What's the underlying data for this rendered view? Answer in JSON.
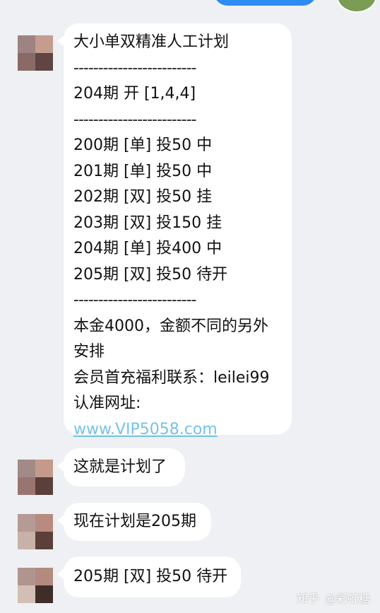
{
  "main_message": {
    "lines": [
      "大小单双精准人工计划",
      "-------------------------",
      "204期 开 [1,4,4]",
      "-------------------------",
      "200期 [单] 投50  中",
      "201期 [单] 投50  中",
      "202期 [双] 投50  挂",
      "203期 [双] 投150  挂",
      "204期 [单] 投400  中",
      "205期 [双] 投50  待开",
      "-------------------------",
      "本金4000，金额不同的另外",
      "安排",
      "会员首充福利联系：leilei99",
      "认准网址:"
    ],
    "link": "www.VIP5058.com"
  },
  "messages": [
    "这就是计划了",
    "现在计划是205期",
    "205期 [双] 投50  待开"
  ],
  "watermark": {
    "site": "知乎",
    "author": "@彩虹糖"
  },
  "colors": {
    "background": "#eef0f3",
    "bubble": "#ffffff",
    "link": "#73c3ea",
    "sent_bubble": "#2f8cf2"
  }
}
